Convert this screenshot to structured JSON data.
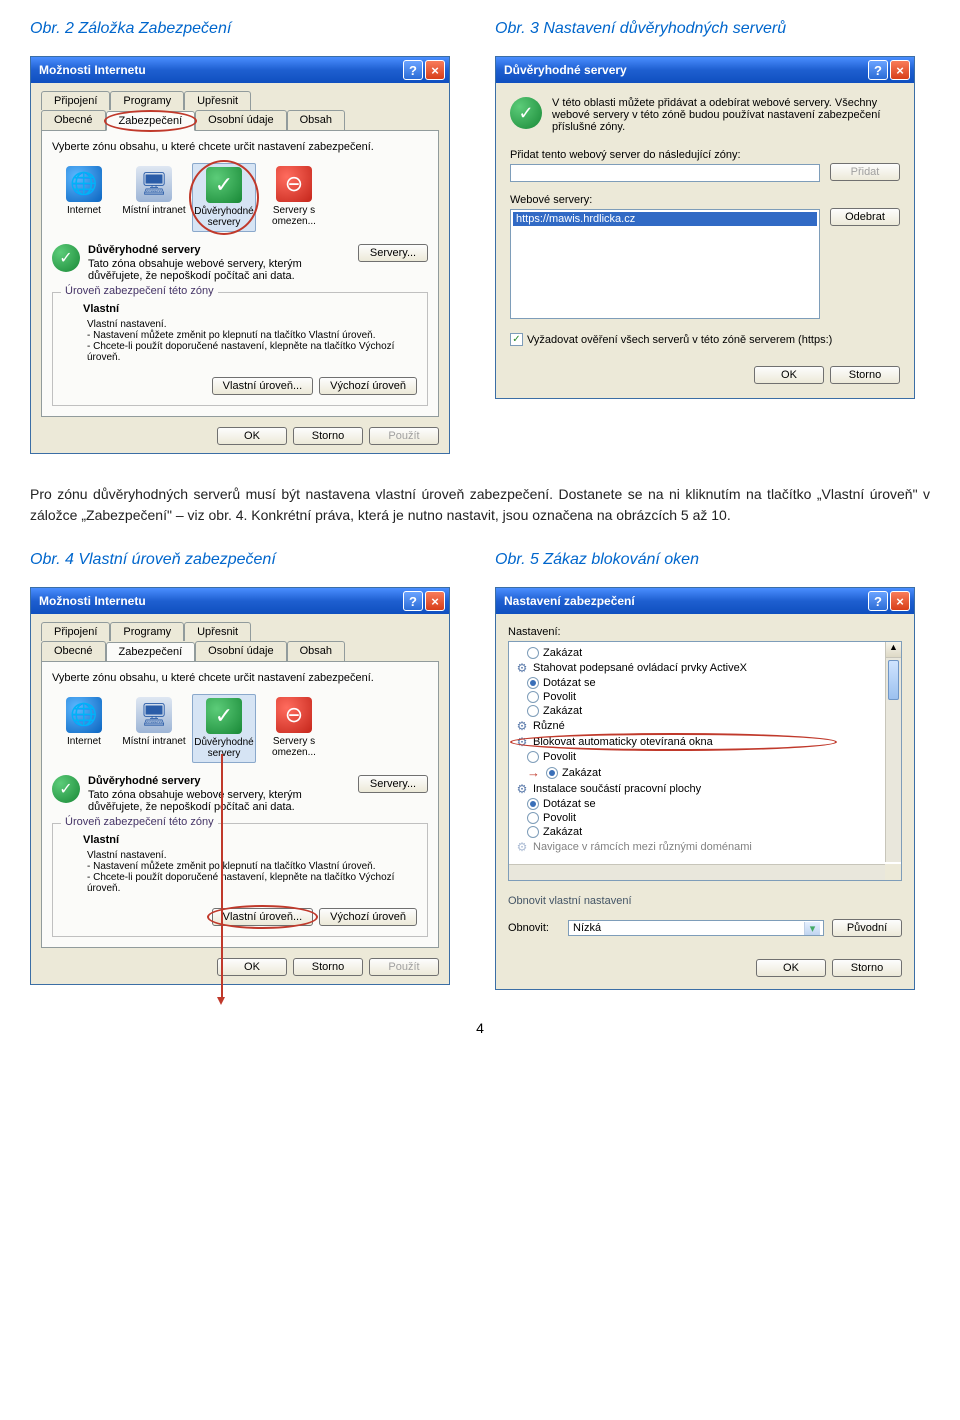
{
  "captions": {
    "c2": "Obr. 2 Záložka Zabezpečení",
    "c3": "Obr. 3 Nastavení důvěryhodných serverů",
    "c4": "Obr. 4 Vlastní úroveň zabezpečení",
    "c5": "Obr. 5 Zákaz blokování oken"
  },
  "paragraph": "Pro zónu důvěryhodných serverů musí být nastavena vlastní úroveň zabezpečení. Dostanete se na ni kliknutím na tlačítko „Vlastní úroveň\" v záložce „Zabezpečení\" – viz obr. 4. Konkrétní práva, která je nutno nastavit, jsou označena na obrázcích 5 až 10.",
  "pagenum": "4",
  "internet_options": {
    "title": "Možnosti Internetu",
    "tabs_row1": [
      "Připojení",
      "Programy",
      "Upřesnit"
    ],
    "tabs_row2": [
      "Obecné",
      "Zabezpečení",
      "Osobní údaje",
      "Obsah"
    ],
    "instruction": "Vyberte zónu obsahu, u které chcete určit nastavení zabezpečení.",
    "zones": {
      "internet": "Internet",
      "intranet": "Místní intranet",
      "trusted": "Důvěryhodné servery",
      "restricted": "Servery s omezen..."
    },
    "info": {
      "title": "Důvěryhodné servery",
      "desc": "Tato zóna obsahuje webové servery, kterým důvěřujete, že nepoškodí počítač ani data."
    },
    "servers_btn": "Servery...",
    "level_legend": "Úroveň zabezpečení této zóny",
    "level": {
      "name": "Vlastní",
      "l1": "Vlastní nastavení.",
      "l2": "- Nastavení můžete změnit po klepnutí na tlačítko Vlastní úroveň.",
      "l3": "- Chcete-li použít doporučené nastavení, klepněte na tlačítko Výchozí úroveň."
    },
    "btn_custom": "Vlastní úroveň...",
    "btn_default": "Výchozí úroveň",
    "btn_ok": "OK",
    "btn_cancel": "Storno",
    "btn_apply": "Použít"
  },
  "trusted_dialog": {
    "title": "Důvěryhodné servery",
    "intro": "V této oblasti můžete přidávat a odebírat webové servery. Všechny webové servery v této zóně budou používat nastavení zabezpečení příslušné zóny.",
    "add_label": "Přidat tento webový server do následující zóny:",
    "add_btn": "Přidat",
    "list_label": "Webové servery:",
    "selected": "https://mawis.hrdlicka.cz",
    "remove_btn": "Odebrat",
    "require_check": "Vyžadovat ověření všech serverů v této zóně serverem (https:)",
    "ok": "OK",
    "cancel": "Storno"
  },
  "sec_settings": {
    "title": "Nastavení zabezpečení",
    "settings_label": "Nastavení:",
    "tree": {
      "zakazat": "Zakázat",
      "cat_activex": "Stahovat podepsané ovládací prvky ActiveX",
      "dotazat": "Dotázat se",
      "povolit": "Povolit",
      "cat_ruzne": "Různé",
      "cat_block": "Blokovat automaticky otevíraná okna",
      "cat_install": "Instalace součástí pracovní plochy",
      "cat_nav": "Navigace ..."
    },
    "reset_title": "Obnovit vlastní nastavení",
    "reset_label": "Obnovit:",
    "reset_value": "Nízká",
    "reset_btn": "Původní",
    "ok": "OK",
    "cancel": "Storno"
  }
}
